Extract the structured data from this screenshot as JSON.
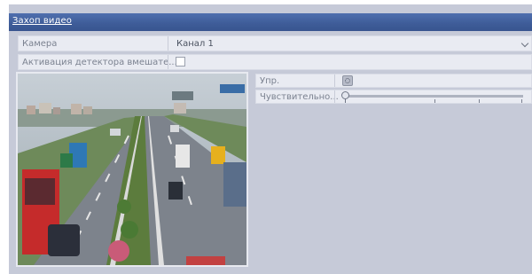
{
  "window": {
    "title": "Захоп видео"
  },
  "form": {
    "camera_label": "Камера",
    "camera_value": "Канал 1",
    "tamper_label": "Активация детектора вмешате...",
    "tamper_checked": false
  },
  "side": {
    "control_label": "Упр.",
    "sensitivity_label": "Чувствительно...",
    "sensitivity_level": 0
  },
  "colors": {
    "titlebar": "#3e5c98",
    "panel": "#c6cad8",
    "row": "#e9ebf2"
  }
}
